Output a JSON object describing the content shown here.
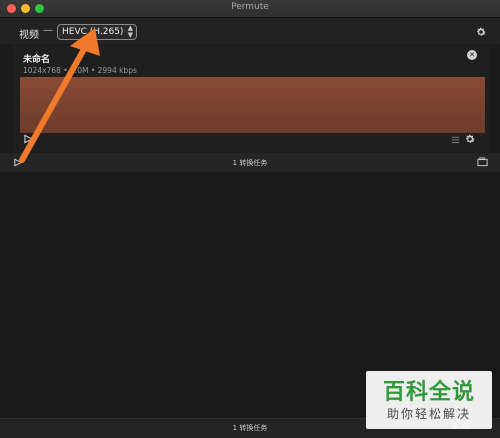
{
  "window": {
    "title": "Permute"
  },
  "toolbar": {
    "category_label": "视频",
    "dash": "—",
    "format_selected": "HEVC (H.265)",
    "select_arrows": "▲▼"
  },
  "job": {
    "title": "未命名",
    "meta": "1024x768 • 1.0M • 2994 kbps",
    "close_glyph": "✕"
  },
  "statusbar": {
    "label": "1 转换任务"
  },
  "bottombar": {
    "label": "1 转换任务",
    "icons": "⊕⊝"
  },
  "watermark": {
    "main": "百科全说",
    "sub": "助你轻松解决"
  },
  "colors": {
    "background": "#1b1b1b",
    "annotation_arrow": "#f07a2a",
    "watermark_green": "#2e9a3b"
  }
}
